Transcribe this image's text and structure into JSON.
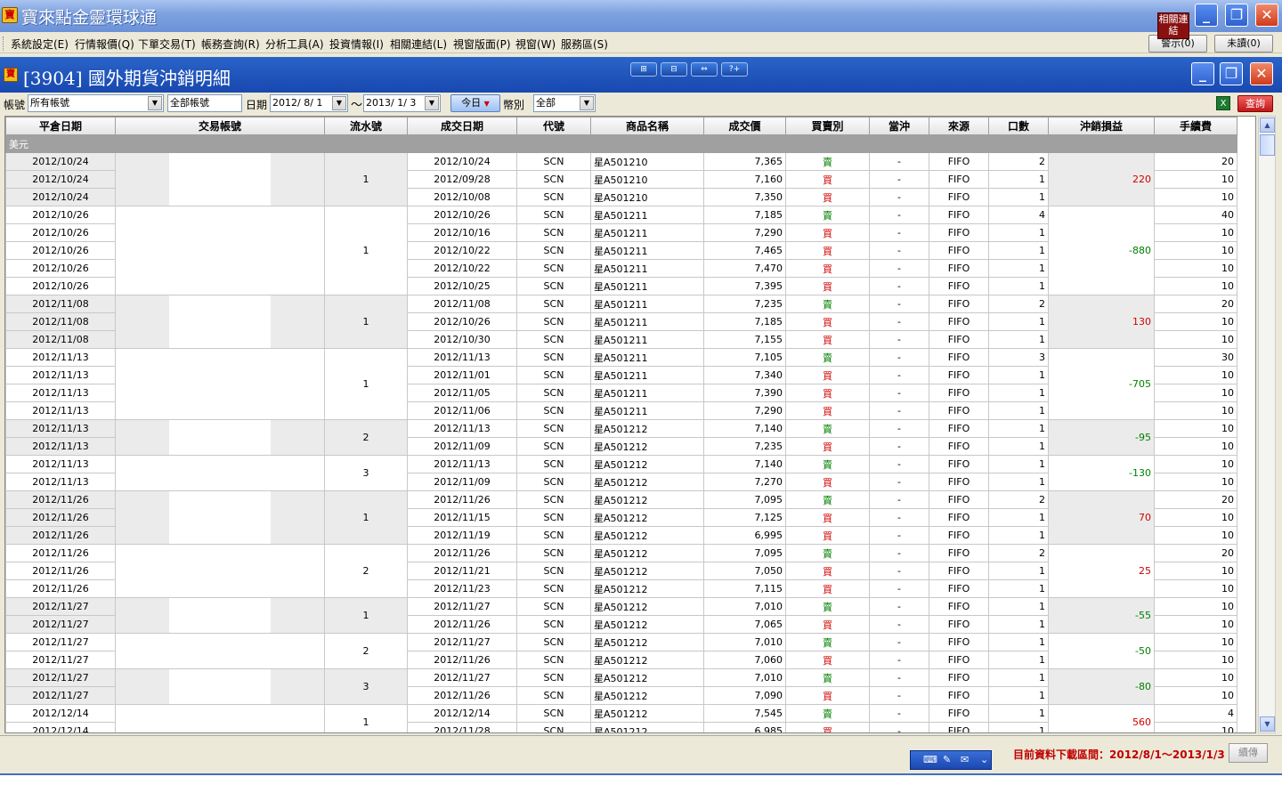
{
  "window": {
    "title": "寶來點金靈環球通",
    "logo": "寶",
    "related_links": "相關連結",
    "notice_btn": "警示(0)",
    "unread_btn": "未讀(0)"
  },
  "menu": [
    "系統設定(E)",
    "行情報價(Q)",
    "下單交易(T)",
    "帳務查詢(R)",
    "分析工具(A)",
    "投資情報(I)",
    "相關連結(L)",
    "視窗版面(P)",
    "視窗(W)",
    "服務區(S)"
  ],
  "panel": {
    "title": "[3904] 國外期貨沖銷明細",
    "logo": "寶",
    "tool_buttons": [
      "⊞",
      "⊟",
      "⇔",
      "?+"
    ]
  },
  "filters": {
    "account_label": "帳號",
    "account_value": "所有帳號",
    "all_accounts_value": "全部帳號",
    "date_label": "日期",
    "date_from": "2012/ 8/ 1",
    "tilde": "～",
    "date_to": "2013/ 1/ 3",
    "today_btn": "今日",
    "currency_label": "幣別",
    "currency_value": "全部",
    "query_btn": "查詢"
  },
  "table": {
    "columns": [
      "平倉日期",
      "交易帳號",
      "流水號",
      "成交日期",
      "代號",
      "商品名稱",
      "成交價",
      "買賣別",
      "當沖",
      "來源",
      "口數",
      "沖銷損益",
      "手續費"
    ],
    "currency_group": "美元",
    "groups": [
      {
        "serial": "1",
        "pnl": "220",
        "sign": "pos",
        "rows": [
          [
            "2012/10/24",
            "2012/10/24",
            "SCN",
            "星A501210",
            "7,365",
            "賣",
            "-",
            "FIFO",
            "2",
            "20"
          ],
          [
            "2012/10/24",
            "2012/09/28",
            "SCN",
            "星A501210",
            "7,160",
            "買",
            "-",
            "FIFO",
            "1",
            "10"
          ],
          [
            "2012/10/24",
            "2012/10/08",
            "SCN",
            "星A501210",
            "7,350",
            "買",
            "-",
            "FIFO",
            "1",
            "10"
          ]
        ]
      },
      {
        "serial": "1",
        "pnl": "-880",
        "sign": "neg",
        "rows": [
          [
            "2012/10/26",
            "2012/10/26",
            "SCN",
            "星A501211",
            "7,185",
            "賣",
            "-",
            "FIFO",
            "4",
            "40"
          ],
          [
            "2012/10/26",
            "2012/10/16",
            "SCN",
            "星A501211",
            "7,290",
            "買",
            "-",
            "FIFO",
            "1",
            "10"
          ],
          [
            "2012/10/26",
            "2012/10/22",
            "SCN",
            "星A501211",
            "7,465",
            "買",
            "-",
            "FIFO",
            "1",
            "10"
          ],
          [
            "2012/10/26",
            "2012/10/22",
            "SCN",
            "星A501211",
            "7,470",
            "買",
            "-",
            "FIFO",
            "1",
            "10"
          ],
          [
            "2012/10/26",
            "2012/10/25",
            "SCN",
            "星A501211",
            "7,395",
            "買",
            "-",
            "FIFO",
            "1",
            "10"
          ]
        ]
      },
      {
        "serial": "1",
        "pnl": "130",
        "sign": "pos",
        "rows": [
          [
            "2012/11/08",
            "2012/11/08",
            "SCN",
            "星A501211",
            "7,235",
            "賣",
            "-",
            "FIFO",
            "2",
            "20"
          ],
          [
            "2012/11/08",
            "2012/10/26",
            "SCN",
            "星A501211",
            "7,185",
            "買",
            "-",
            "FIFO",
            "1",
            "10"
          ],
          [
            "2012/11/08",
            "2012/10/30",
            "SCN",
            "星A501211",
            "7,155",
            "買",
            "-",
            "FIFO",
            "1",
            "10"
          ]
        ]
      },
      {
        "serial": "1",
        "pnl": "-705",
        "sign": "neg",
        "rows": [
          [
            "2012/11/13",
            "2012/11/13",
            "SCN",
            "星A501211",
            "7,105",
            "賣",
            "-",
            "FIFO",
            "3",
            "30"
          ],
          [
            "2012/11/13",
            "2012/11/01",
            "SCN",
            "星A501211",
            "7,340",
            "買",
            "-",
            "FIFO",
            "1",
            "10"
          ],
          [
            "2012/11/13",
            "2012/11/05",
            "SCN",
            "星A501211",
            "7,390",
            "買",
            "-",
            "FIFO",
            "1",
            "10"
          ],
          [
            "2012/11/13",
            "2012/11/06",
            "SCN",
            "星A501211",
            "7,290",
            "買",
            "-",
            "FIFO",
            "1",
            "10"
          ]
        ]
      },
      {
        "serial": "2",
        "pnl": "-95",
        "sign": "neg",
        "rows": [
          [
            "2012/11/13",
            "2012/11/13",
            "SCN",
            "星A501212",
            "7,140",
            "賣",
            "-",
            "FIFO",
            "1",
            "10"
          ],
          [
            "2012/11/13",
            "2012/11/09",
            "SCN",
            "星A501212",
            "7,235",
            "買",
            "-",
            "FIFO",
            "1",
            "10"
          ]
        ]
      },
      {
        "serial": "3",
        "pnl": "-130",
        "sign": "neg",
        "rows": [
          [
            "2012/11/13",
            "2012/11/13",
            "SCN",
            "星A501212",
            "7,140",
            "賣",
            "-",
            "FIFO",
            "1",
            "10"
          ],
          [
            "2012/11/13",
            "2012/11/09",
            "SCN",
            "星A501212",
            "7,270",
            "買",
            "-",
            "FIFO",
            "1",
            "10"
          ]
        ]
      },
      {
        "serial": "1",
        "pnl": "70",
        "sign": "pos",
        "rows": [
          [
            "2012/11/26",
            "2012/11/26",
            "SCN",
            "星A501212",
            "7,095",
            "賣",
            "-",
            "FIFO",
            "2",
            "20"
          ],
          [
            "2012/11/26",
            "2012/11/15",
            "SCN",
            "星A501212",
            "7,125",
            "買",
            "-",
            "FIFO",
            "1",
            "10"
          ],
          [
            "2012/11/26",
            "2012/11/19",
            "SCN",
            "星A501212",
            "6,995",
            "買",
            "-",
            "FIFO",
            "1",
            "10"
          ]
        ]
      },
      {
        "serial": "2",
        "pnl": "25",
        "sign": "pos",
        "rows": [
          [
            "2012/11/26",
            "2012/11/26",
            "SCN",
            "星A501212",
            "7,095",
            "賣",
            "-",
            "FIFO",
            "2",
            "20"
          ],
          [
            "2012/11/26",
            "2012/11/21",
            "SCN",
            "星A501212",
            "7,050",
            "買",
            "-",
            "FIFO",
            "1",
            "10"
          ],
          [
            "2012/11/26",
            "2012/11/23",
            "SCN",
            "星A501212",
            "7,115",
            "買",
            "-",
            "FIFO",
            "1",
            "10"
          ]
        ]
      },
      {
        "serial": "1",
        "pnl": "-55",
        "sign": "neg",
        "rows": [
          [
            "2012/11/27",
            "2012/11/27",
            "SCN",
            "星A501212",
            "7,010",
            "賣",
            "-",
            "FIFO",
            "1",
            "10"
          ],
          [
            "2012/11/27",
            "2012/11/26",
            "SCN",
            "星A501212",
            "7,065",
            "買",
            "-",
            "FIFO",
            "1",
            "10"
          ]
        ]
      },
      {
        "serial": "2",
        "pnl": "-50",
        "sign": "neg",
        "rows": [
          [
            "2012/11/27",
            "2012/11/27",
            "SCN",
            "星A501212",
            "7,010",
            "賣",
            "-",
            "FIFO",
            "1",
            "10"
          ],
          [
            "2012/11/27",
            "2012/11/26",
            "SCN",
            "星A501212",
            "7,060",
            "買",
            "-",
            "FIFO",
            "1",
            "10"
          ]
        ]
      },
      {
        "serial": "3",
        "pnl": "-80",
        "sign": "neg",
        "rows": [
          [
            "2012/11/27",
            "2012/11/27",
            "SCN",
            "星A501212",
            "7,010",
            "賣",
            "-",
            "FIFO",
            "1",
            "10"
          ],
          [
            "2012/11/27",
            "2012/11/26",
            "SCN",
            "星A501212",
            "7,090",
            "買",
            "-",
            "FIFO",
            "1",
            "10"
          ]
        ]
      },
      {
        "serial": "1",
        "pnl": "560",
        "sign": "pos",
        "rows": [
          [
            "2012/12/14",
            "2012/12/14",
            "SCN",
            "星A501212",
            "7,545",
            "賣",
            "-",
            "FIFO",
            "1",
            "4"
          ],
          [
            "2012/12/14",
            "2012/11/28",
            "SCN",
            "星A501212",
            "6,985",
            "買",
            "-",
            "FIFO",
            "1",
            "10"
          ]
        ]
      }
    ]
  },
  "status": {
    "message": "目前資料下載區間：2012/8/1～2013/1/3",
    "continue_btn": "續傳"
  },
  "ime": [
    "⌨",
    "✎",
    "✉",
    "⌄"
  ],
  "colors": {
    "sell": "#008000",
    "buy": "#d00000",
    "title_blue": "#1848b0"
  }
}
